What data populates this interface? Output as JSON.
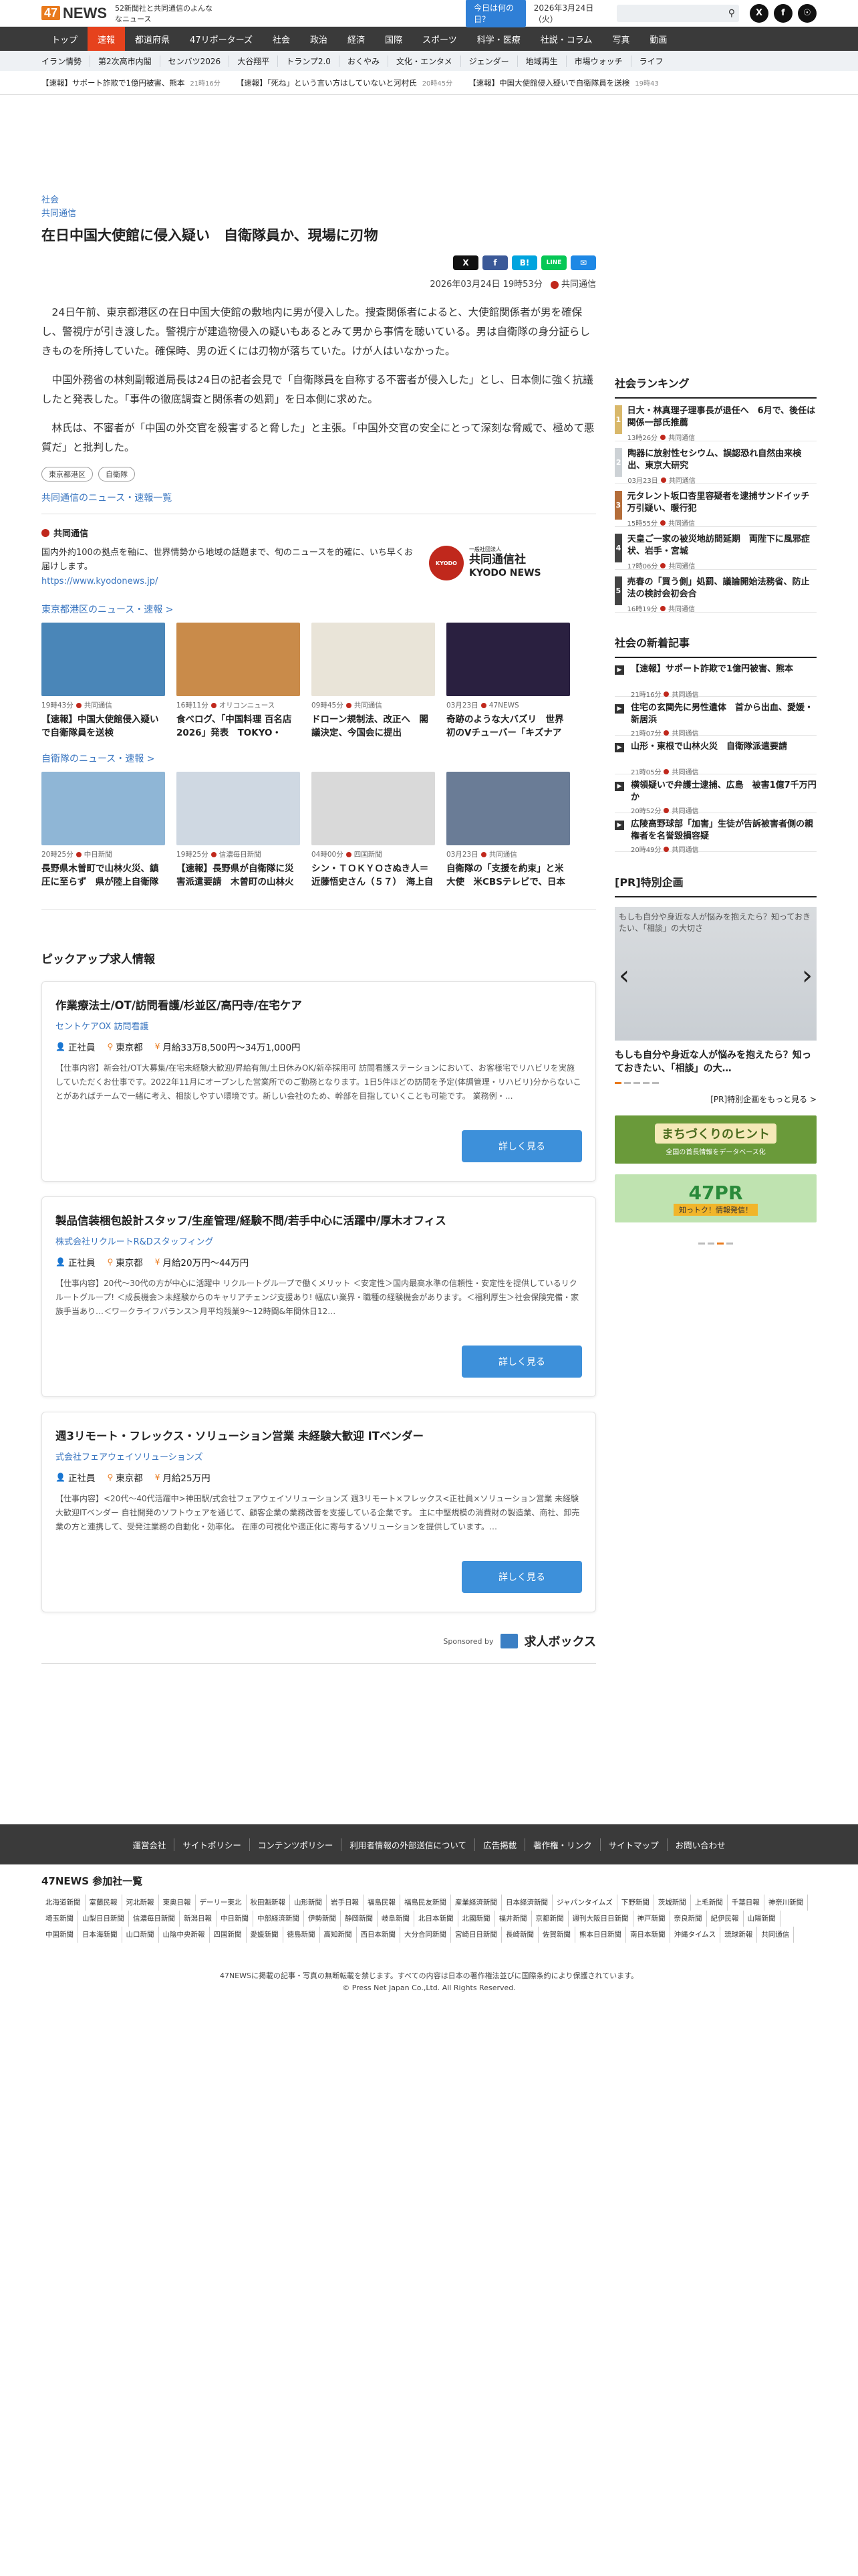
{
  "header": {
    "logo_num": "47",
    "logo_word": "NEWS",
    "tagline": "52新聞社と共同通信のよんななニュース",
    "today_button": "今日は何の日？",
    "date": "2026年3月24日（火）",
    "search_placeholder": ""
  },
  "nav_main": [
    "トップ",
    "速報",
    "都道府県",
    "47リポーターズ",
    "社会",
    "政治",
    "経済",
    "国際",
    "スポーツ",
    "科学・医療",
    "社説・コラム",
    "写真",
    "動画"
  ],
  "nav_sub": [
    "イラン情勢",
    "第2次高市内閣",
    "センバツ2026",
    "大谷翔平",
    "トランプ2.0",
    "おくやみ",
    "文化・エンタメ",
    "ジェンダー",
    "地域再生",
    "市場ウォッチ",
    "ライフ"
  ],
  "ticker": [
    {
      "text": "【速報】サポート詐欺で1億円被害、熊本",
      "time": "21時16分"
    },
    {
      "text": "【速報】「死ね」という言い方はしていないと河村氏",
      "time": "20時45分"
    },
    {
      "text": "【速報】中国大使館侵入疑いで自衛隊員を送検",
      "time": "19時43"
    }
  ],
  "article": {
    "category": "社会",
    "source": "共同通信",
    "headline": "在日中国大使館に侵入疑い　自衛隊員か、現場に刃物",
    "byline_time": "2026年03月24日 19時53分",
    "byline_source": "共同通信",
    "paragraphs": [
      "24日午前、東京都港区の在日中国大使館の敷地内に男が侵入した。捜査関係者によると、大使館関係者が男を確保し、警視庁が引き渡した。警視庁が建造物侵入の疑いもあるとみて男から事情を聴いている。男は自衛隊の身分証らしきものを所持していた。確保時、男の近くには刃物が落ちていた。けが人はいなかった。",
      "中国外務省の林剣副報道局長は24日の記者会見で「自衛隊員を自称する不審者が侵入した」とし、日本側に強く抗議したと発表した。「事件の徹底調査と関係者の処罰」を日本側に求めた。",
      "林氏は、不審者が「中国の外交官を殺害すると脅した」と主張。「中国外交官の安全にとって深刻な脅威で、極めて悪質だ」と批判した。"
    ],
    "tags": [
      "東京都港区",
      "自衛隊"
    ],
    "more_link": "共同通信のニュース・速報一覧"
  },
  "share": [
    "X",
    "f",
    "B!",
    "LINE",
    "✉"
  ],
  "kyodo": {
    "name": "共同通信",
    "desc": "国内外約100の拠点を軸に、世界情勢から地域の話題まで、旬のニュースを的確に、いち早くお届けします。",
    "url": "https://www.kyodonews.jp/",
    "logo_circle": "KYODO",
    "logo_small": "一般社団法人",
    "logo_jp": "共同通信社",
    "logo_en": "KYODO NEWS"
  },
  "section_tokyo": {
    "title": "東京都港区のニュース・速報 >",
    "cards": [
      {
        "time": "19時43分",
        "source": "共同通信",
        "title": "【速報】中国大使館侵入疑いで自衛隊員を送検",
        "color": "#4a86b8"
      },
      {
        "time": "16時11分",
        "source": "オリコンニュース",
        "title": "食べログ、「中国料理 百名店 2026」発表　TOKYO・EAST・…",
        "color": "#c98b4a"
      },
      {
        "time": "09時45分",
        "source": "共同通信",
        "title": "ドローン規制法、改正へ　閣議決定、今国会に提出",
        "color": "#e9e4d8"
      },
      {
        "time": "03月23日",
        "source": "47NEWS",
        "title": "奇跡のような大バズリ　世界初のVチューバー「キズナアイ」は喫茶…",
        "color": "#2a2040"
      }
    ]
  },
  "section_sdf": {
    "title": "自衛隊のニュース・速報 >",
    "cards": [
      {
        "time": "20時25分",
        "source": "中日新聞",
        "title": "長野県木曽町で山林火災、鎮圧に至らず　県が陸上自衛隊に災害派遣…",
        "color": "#8fb6d6"
      },
      {
        "time": "19時25分",
        "source": "信濃毎日新聞",
        "title": "【速報】長野県が自衛隊に災害派遣要請　木曽町の山林火災で",
        "color": "#cfd8e2"
      },
      {
        "time": "04時00分",
        "source": "四国新聞",
        "title": "シン・ＴＯＫＹＯさぬき人＝近藤悟史さん（５７）　海上自衛隊東京…",
        "color": "#d9d9d9"
      },
      {
        "time": "03月23日",
        "source": "共同通信",
        "title": "自衛隊の「支援を約束」と米大使　米CBSテレビで、日本は役論",
        "color": "#6a7c96"
      }
    ]
  },
  "pickup": {
    "title": "ピックアップ求人情報",
    "jobs": [
      {
        "title": "作業療法士/OT/訪問看護/杉並区/高円寺/在宅ケア",
        "company": "セントケアOX 訪問看護",
        "type": "正社員",
        "place": "東京都",
        "salary": "月給33万8,500円〜34万1,000円",
        "desc": "【仕事内容】新会社/OT大募集/在宅未経験大歓迎/昇給有無/土日休みOK/新卒採用可 訪問看護ステーションにおいて、お客様宅でリハビリを実施していただくお仕事です。2022年11月にオープンした営業所でのご勤務となります。1日5件ほどの訪問を予定(体調管理・リハビリ)分からないことがあればチームで一緒に考え、相談しやすい環境です。新しい会社のため、幹部を目指していくことも可能です。 業務例・…",
        "button": "詳しく見る"
      },
      {
        "title": "製品信装梱包設計スタッフ/生産管理/経験不問/若手中心に活躍中/厚木オフィス",
        "company": "株式会社リクルートR&Dスタッフィング",
        "type": "正社員",
        "place": "東京都",
        "salary": "月給20万円〜44万円",
        "desc": "【仕事内容】20代〜30代の方が中心に活躍中 リクルートグループで働くメリット ＜安定性＞国内最高水準の信頼性・安定性を提供しているリクルートグループ! ＜成長機会＞未経験からのキャリアチェンジ支援あり! 幅広い業界・職種の経験機会があります。＜福利厚生＞社会保険完備・家族手当あり…＜ワークライフバランス＞月平均残業9〜12時間&年間休日12…",
        "button": "詳しく見る"
      },
      {
        "title": "週3リモート・フレックス・ソリューション営業 未経験大歓迎 ITベンダー",
        "company": "式会社フェアウェイソリューションズ",
        "type": "正社員",
        "place": "東京都",
        "salary": "月給25万円",
        "desc": "【仕事内容】<20代〜40代活躍中>神田駅/式会社フェアウェイソリューションズ 週3リモート×フレックス<正社員×ソリューション営業 未経験大歓迎ITベンダー 自社開発のソフトウェアを通じて、顧客企業の業務改善を支援している企業です。 主に中堅規模の消費財の製造業、商社、卸売業の方と連携して、受発注業務の自動化・効率化。 在庫の可視化や適正化に寄与するソリューションを提供しています。…",
        "button": "詳しく見る"
      }
    ],
    "sponsor_label": "Sponsored by",
    "sponsor_name": "求人ボックス"
  },
  "ranking": {
    "title": "社会ランキング",
    "items": [
      {
        "num": "1",
        "title": "日大・林真理子理事長が退任へ　6月で、後任は関係一部氏推薦",
        "time": "13時26分",
        "source": "共同通信",
        "color": "#d9b86a"
      },
      {
        "num": "2",
        "title": "陶器に放射性セシウム、誤認恐れ自然由来検出、東京大研究",
        "time": "03月23日",
        "source": "共同通信",
        "color": "#cdd2d6"
      },
      {
        "num": "3",
        "title": "元タレント坂口杏里容疑者を逮捕サンドイッチ万引疑い、暖行犯",
        "time": "15時55分",
        "source": "共同通信",
        "color": "#b46d3a"
      },
      {
        "num": "4",
        "title": "天皇ご一家の被災地訪問延期　両陛下に風邪症状、岩手・宮城",
        "time": "17時06分",
        "source": "共同通信",
        "color": "#444"
      },
      {
        "num": "5",
        "title": "売春の「買う側」処罰、議論開始法務省、防止法の検討会初会合",
        "time": "16時19分",
        "source": "共同通信",
        "color": "#444"
      }
    ]
  },
  "new_articles": {
    "title": "社会の新着記事",
    "items": [
      {
        "title": "【速報】サポート詐欺で1億円被害、熊本",
        "time": "21時16分",
        "source": "共同通信"
      },
      {
        "title": "住宅の玄関先に男性遺体　首から出血、愛媛・新居浜",
        "time": "21時07分",
        "source": "共同通信"
      },
      {
        "title": "山形・東根で山林火災　自衛隊派遣要請",
        "time": "21時05分",
        "source": "共同通信"
      },
      {
        "title": "横領疑いで弁護士逮捕、広島　被害1億7千万円か",
        "time": "20時52分",
        "source": "共同通信"
      },
      {
        "title": "広陵高野球部「加害」生徒が告訴被害者側の親権者を名誉毀損容疑",
        "time": "20時49分",
        "source": "共同通信"
      }
    ]
  },
  "pr": {
    "title": "[PR]特別企画",
    "slide_caption": "もしも自分や身近な人が悩みを抱えたら？知っておきたい、「相談」の大切さ",
    "slide_title": "もしも自分や身近な人が悩みを抱えたら？知っておきたい、「相談」の大…",
    "link": "[PR]特別企画をもっと見る >",
    "banner1": "まちづくりのヒント",
    "banner1_sub": "全国の首長情報をデータベース化",
    "banner2": "47PR",
    "banner2_sub": "知っトク！情報発信！"
  },
  "footer": {
    "links": [
      "運営会社",
      "サイトポリシー",
      "コンテンツポリシー",
      "利用者情報の外部送信について",
      "広告掲載",
      "著作権・リンク",
      "サイトマップ",
      "お問い合わせ"
    ],
    "members_title": "47NEWS 参加社一覧",
    "members": [
      "北海道新聞",
      "室蘭民報",
      "河北新報",
      "東奥日報",
      "デーリー東北",
      "秋田魁新報",
      "山形新聞",
      "岩手日報",
      "福島民報",
      "福島民友新聞",
      "産業経済新聞",
      "日本経済新聞",
      "ジャパンタイムズ",
      "下野新聞",
      "茨城新聞",
      "上毛新聞",
      "千葉日報",
      "神奈川新聞",
      "埼玉新聞",
      "山梨日日新聞",
      "信濃毎日新聞",
      "新潟日報",
      "中日新聞",
      "中部経済新聞",
      "伊勢新聞",
      "静岡新聞",
      "岐阜新聞",
      "北日本新聞",
      "北國新聞",
      "福井新聞",
      "京都新聞",
      "週刊大阪日日新聞",
      "神戸新聞",
      "奈良新聞",
      "紀伊民報",
      "山陽新聞",
      "中国新聞",
      "日本海新聞",
      "山口新聞",
      "山陰中央新報",
      "四国新聞",
      "愛媛新聞",
      "徳島新聞",
      "高知新聞",
      "西日本新聞",
      "大分合同新聞",
      "宮崎日日新聞",
      "長崎新聞",
      "佐賀新聞",
      "熊本日日新聞",
      "南日本新聞",
      "沖縄タイムス",
      "琉球新報",
      "共同通信"
    ],
    "copy1": "47NEWSに掲載の記事・写真の無断転載を禁じます。すべての内容は日本の著作権法並びに国際条約により保護されています。",
    "copy2": "© Press Net Japan Co.,Ltd. All Rights Reserved."
  },
  "colors": {
    "accent": "#e6421d",
    "brand": "#e97a1d",
    "link": "#3a76c0",
    "button": "#3d90da"
  }
}
